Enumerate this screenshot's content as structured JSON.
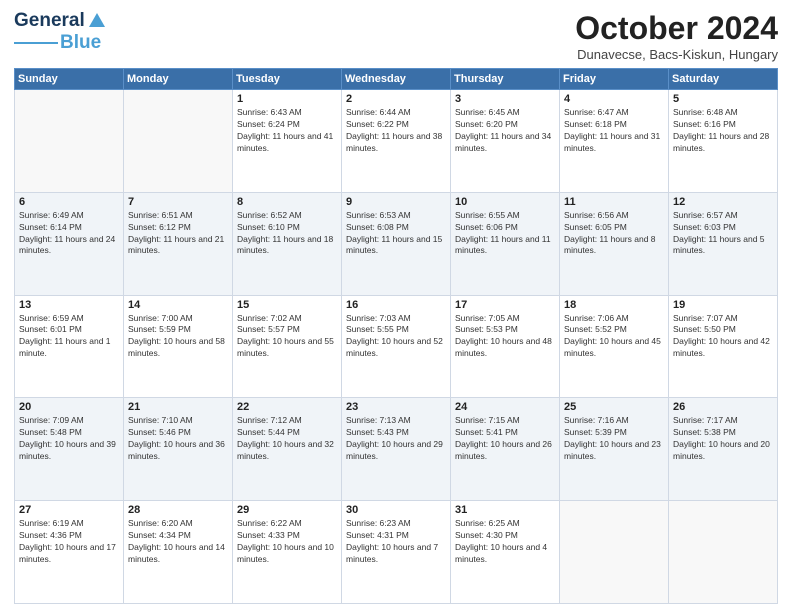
{
  "logo": {
    "line1": "General",
    "line2": "Blue"
  },
  "header": {
    "title": "October 2024",
    "subtitle": "Dunavecse, Bacs-Kiskun, Hungary"
  },
  "weekdays": [
    "Sunday",
    "Monday",
    "Tuesday",
    "Wednesday",
    "Thursday",
    "Friday",
    "Saturday"
  ],
  "weeks": [
    [
      {
        "day": "",
        "info": ""
      },
      {
        "day": "",
        "info": ""
      },
      {
        "day": "1",
        "info": "Sunrise: 6:43 AM\nSunset: 6:24 PM\nDaylight: 11 hours and 41 minutes."
      },
      {
        "day": "2",
        "info": "Sunrise: 6:44 AM\nSunset: 6:22 PM\nDaylight: 11 hours and 38 minutes."
      },
      {
        "day": "3",
        "info": "Sunrise: 6:45 AM\nSunset: 6:20 PM\nDaylight: 11 hours and 34 minutes."
      },
      {
        "day": "4",
        "info": "Sunrise: 6:47 AM\nSunset: 6:18 PM\nDaylight: 11 hours and 31 minutes."
      },
      {
        "day": "5",
        "info": "Sunrise: 6:48 AM\nSunset: 6:16 PM\nDaylight: 11 hours and 28 minutes."
      }
    ],
    [
      {
        "day": "6",
        "info": "Sunrise: 6:49 AM\nSunset: 6:14 PM\nDaylight: 11 hours and 24 minutes."
      },
      {
        "day": "7",
        "info": "Sunrise: 6:51 AM\nSunset: 6:12 PM\nDaylight: 11 hours and 21 minutes."
      },
      {
        "day": "8",
        "info": "Sunrise: 6:52 AM\nSunset: 6:10 PM\nDaylight: 11 hours and 18 minutes."
      },
      {
        "day": "9",
        "info": "Sunrise: 6:53 AM\nSunset: 6:08 PM\nDaylight: 11 hours and 15 minutes."
      },
      {
        "day": "10",
        "info": "Sunrise: 6:55 AM\nSunset: 6:06 PM\nDaylight: 11 hours and 11 minutes."
      },
      {
        "day": "11",
        "info": "Sunrise: 6:56 AM\nSunset: 6:05 PM\nDaylight: 11 hours and 8 minutes."
      },
      {
        "day": "12",
        "info": "Sunrise: 6:57 AM\nSunset: 6:03 PM\nDaylight: 11 hours and 5 minutes."
      }
    ],
    [
      {
        "day": "13",
        "info": "Sunrise: 6:59 AM\nSunset: 6:01 PM\nDaylight: 11 hours and 1 minute."
      },
      {
        "day": "14",
        "info": "Sunrise: 7:00 AM\nSunset: 5:59 PM\nDaylight: 10 hours and 58 minutes."
      },
      {
        "day": "15",
        "info": "Sunrise: 7:02 AM\nSunset: 5:57 PM\nDaylight: 10 hours and 55 minutes."
      },
      {
        "day": "16",
        "info": "Sunrise: 7:03 AM\nSunset: 5:55 PM\nDaylight: 10 hours and 52 minutes."
      },
      {
        "day": "17",
        "info": "Sunrise: 7:05 AM\nSunset: 5:53 PM\nDaylight: 10 hours and 48 minutes."
      },
      {
        "day": "18",
        "info": "Sunrise: 7:06 AM\nSunset: 5:52 PM\nDaylight: 10 hours and 45 minutes."
      },
      {
        "day": "19",
        "info": "Sunrise: 7:07 AM\nSunset: 5:50 PM\nDaylight: 10 hours and 42 minutes."
      }
    ],
    [
      {
        "day": "20",
        "info": "Sunrise: 7:09 AM\nSunset: 5:48 PM\nDaylight: 10 hours and 39 minutes."
      },
      {
        "day": "21",
        "info": "Sunrise: 7:10 AM\nSunset: 5:46 PM\nDaylight: 10 hours and 36 minutes."
      },
      {
        "day": "22",
        "info": "Sunrise: 7:12 AM\nSunset: 5:44 PM\nDaylight: 10 hours and 32 minutes."
      },
      {
        "day": "23",
        "info": "Sunrise: 7:13 AM\nSunset: 5:43 PM\nDaylight: 10 hours and 29 minutes."
      },
      {
        "day": "24",
        "info": "Sunrise: 7:15 AM\nSunset: 5:41 PM\nDaylight: 10 hours and 26 minutes."
      },
      {
        "day": "25",
        "info": "Sunrise: 7:16 AM\nSunset: 5:39 PM\nDaylight: 10 hours and 23 minutes."
      },
      {
        "day": "26",
        "info": "Sunrise: 7:17 AM\nSunset: 5:38 PM\nDaylight: 10 hours and 20 minutes."
      }
    ],
    [
      {
        "day": "27",
        "info": "Sunrise: 6:19 AM\nSunset: 4:36 PM\nDaylight: 10 hours and 17 minutes."
      },
      {
        "day": "28",
        "info": "Sunrise: 6:20 AM\nSunset: 4:34 PM\nDaylight: 10 hours and 14 minutes."
      },
      {
        "day": "29",
        "info": "Sunrise: 6:22 AM\nSunset: 4:33 PM\nDaylight: 10 hours and 10 minutes."
      },
      {
        "day": "30",
        "info": "Sunrise: 6:23 AM\nSunset: 4:31 PM\nDaylight: 10 hours and 7 minutes."
      },
      {
        "day": "31",
        "info": "Sunrise: 6:25 AM\nSunset: 4:30 PM\nDaylight: 10 hours and 4 minutes."
      },
      {
        "day": "",
        "info": ""
      },
      {
        "day": "",
        "info": ""
      }
    ]
  ]
}
